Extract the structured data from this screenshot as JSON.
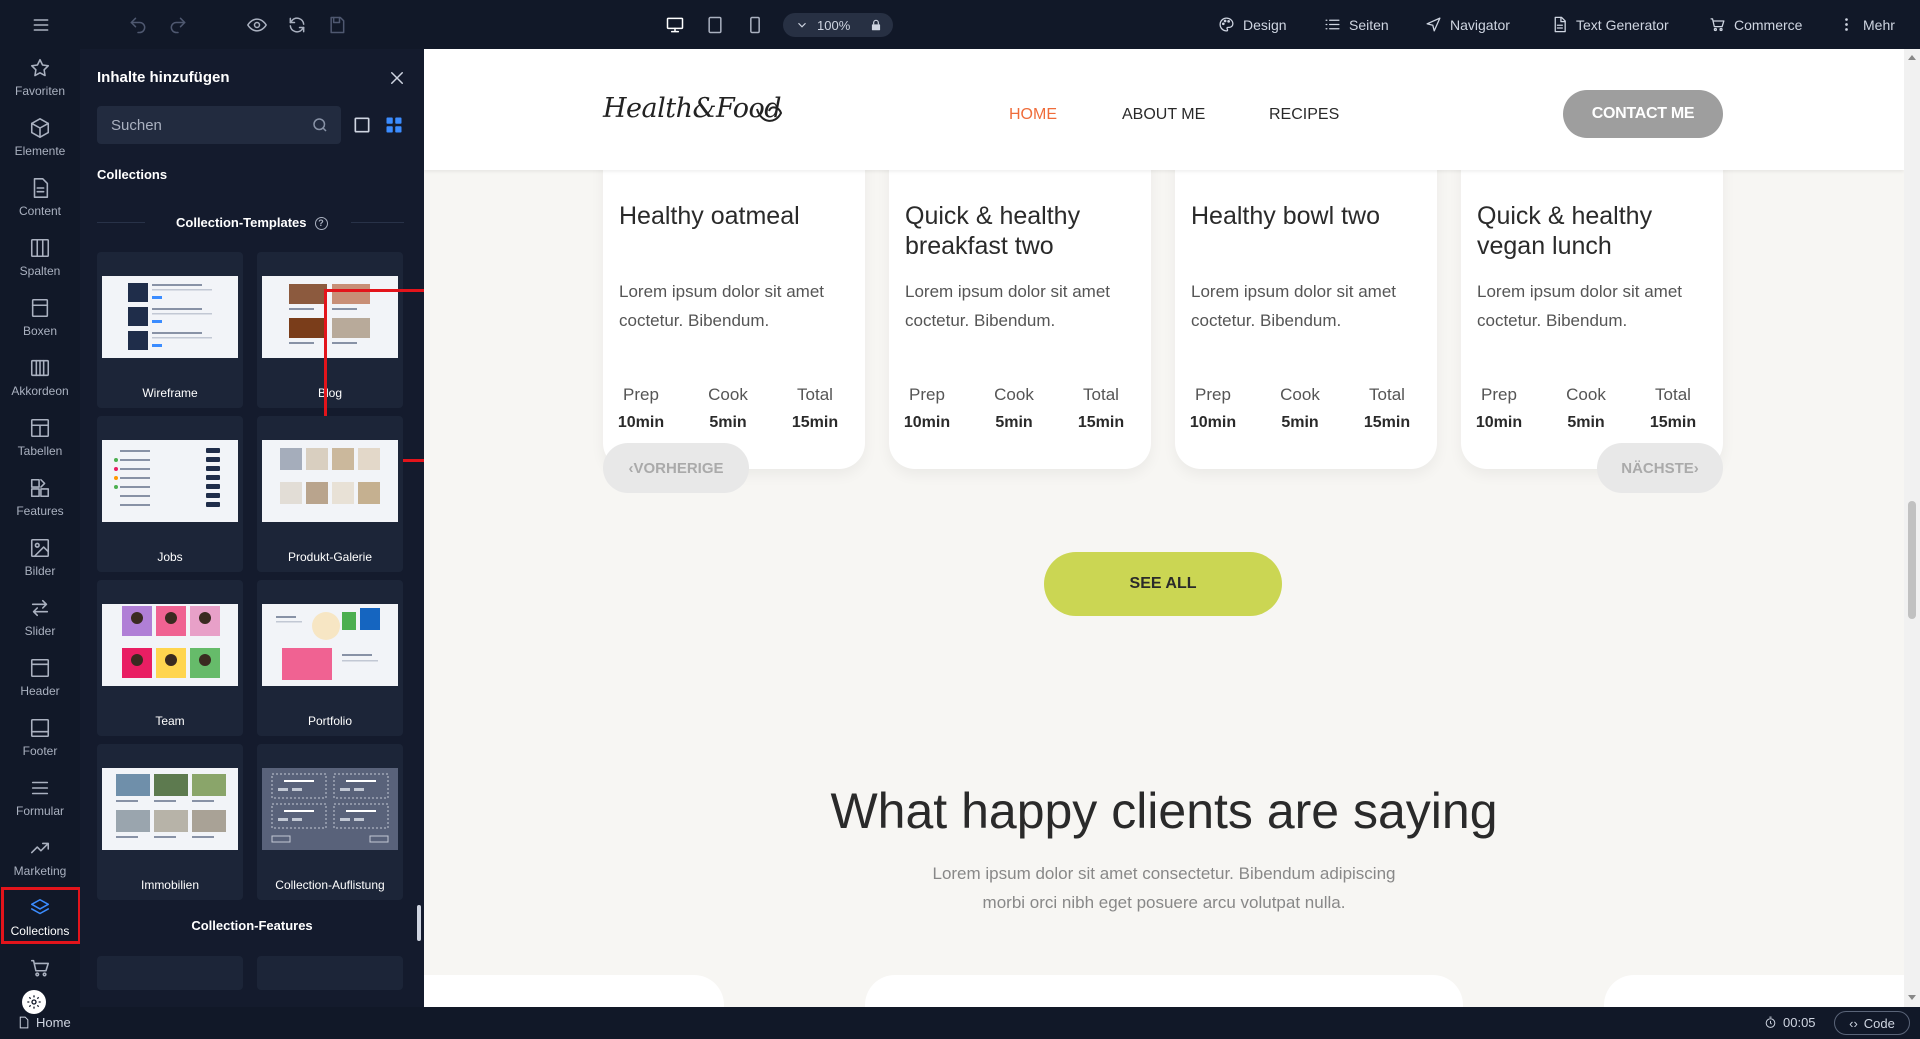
{
  "toolbar": {
    "zoom": "100%",
    "menu": [
      {
        "label": "Design",
        "icon": "palette-icon"
      },
      {
        "label": "Seiten",
        "icon": "list-icon"
      },
      {
        "label": "Navigator",
        "icon": "navigation-arrow-icon"
      },
      {
        "label": "Text Generator",
        "icon": "document-icon"
      },
      {
        "label": "Commerce",
        "icon": "cart-icon"
      },
      {
        "label": "Mehr",
        "icon": "kebab-icon"
      }
    ]
  },
  "rail": {
    "items": [
      {
        "label": "Favoriten",
        "icon": "star-icon"
      },
      {
        "label": "Elemente",
        "icon": "cube-icon"
      },
      {
        "label": "Content",
        "icon": "document-icon"
      },
      {
        "label": "Spalten",
        "icon": "columns-icon"
      },
      {
        "label": "Boxen",
        "icon": "box-icon"
      },
      {
        "label": "Akkordeon",
        "icon": "accordion-icon"
      },
      {
        "label": "Tabellen",
        "icon": "table-icon"
      },
      {
        "label": "Features",
        "icon": "features-icon"
      },
      {
        "label": "Bilder",
        "icon": "image-icon"
      },
      {
        "label": "Slider",
        "icon": "slider-arrows-icon"
      },
      {
        "label": "Header",
        "icon": "header-icon"
      },
      {
        "label": "Footer",
        "icon": "footer-icon"
      },
      {
        "label": "Formular",
        "icon": "form-icon"
      },
      {
        "label": "Marketing",
        "icon": "trending-icon"
      },
      {
        "label": "Collections",
        "icon": "layers-icon",
        "active": true
      }
    ]
  },
  "panel": {
    "title": "Inhalte hinzufügen",
    "search_placeholder": "Suchen",
    "collections_label": "Collections",
    "templates_label": "Collection-Templates",
    "features_label": "Collection-Features",
    "cards": [
      "Wireframe",
      "Blog",
      "Jobs",
      "Produkt-Galerie",
      "Team",
      "Portfolio",
      "Immobilien",
      "Collection-Auflistung"
    ]
  },
  "bottom": {
    "home": "Home",
    "timer": "00:05",
    "code": "Code"
  },
  "site": {
    "logo": "Health&Food",
    "nav": [
      "HOME",
      "ABOUT ME",
      "RECIPES"
    ],
    "contact": "CONTACT ME",
    "recipes": [
      {
        "title": "Healthy oatmeal",
        "desc": "Lorem ipsum dolor sit amet coctetur. Bibendum.",
        "prep": "10min",
        "cook": "5min",
        "total": "15min"
      },
      {
        "title": "Quick & healthy breakfast two",
        "desc": "Lorem ipsum dolor sit amet coctetur. Bibendum.",
        "prep": "10min",
        "cook": "5min",
        "total": "15min"
      },
      {
        "title": "Healthy bowl two",
        "desc": "Lorem ipsum dolor sit amet coctetur. Bibendum.",
        "prep": "10min",
        "cook": "5min",
        "total": "15min"
      },
      {
        "title": "Quick & healthy vegan lunch",
        "desc": "Lorem ipsum dolor sit amet coctetur. Bibendum.",
        "prep": "10min",
        "cook": "5min",
        "total": "15min"
      }
    ],
    "meta_labels": {
      "prep": "Prep",
      "cook": "Cook",
      "total": "Total"
    },
    "prev": "VORHERIGE",
    "next": "NÄCHSTE",
    "see_all": "SEE ALL",
    "testimonials_title": "What happy clients are saying",
    "testimonials_sub": "Lorem ipsum dolor sit amet consectetur. Bibendum adipiscing morbi orci nibh eget posuere arcu volutpat nulla."
  },
  "colors": {
    "accent": "#3b8cff",
    "highlight": "#e3141b",
    "nav_active": "#ef6c3a",
    "see_all": "#cbd653"
  }
}
